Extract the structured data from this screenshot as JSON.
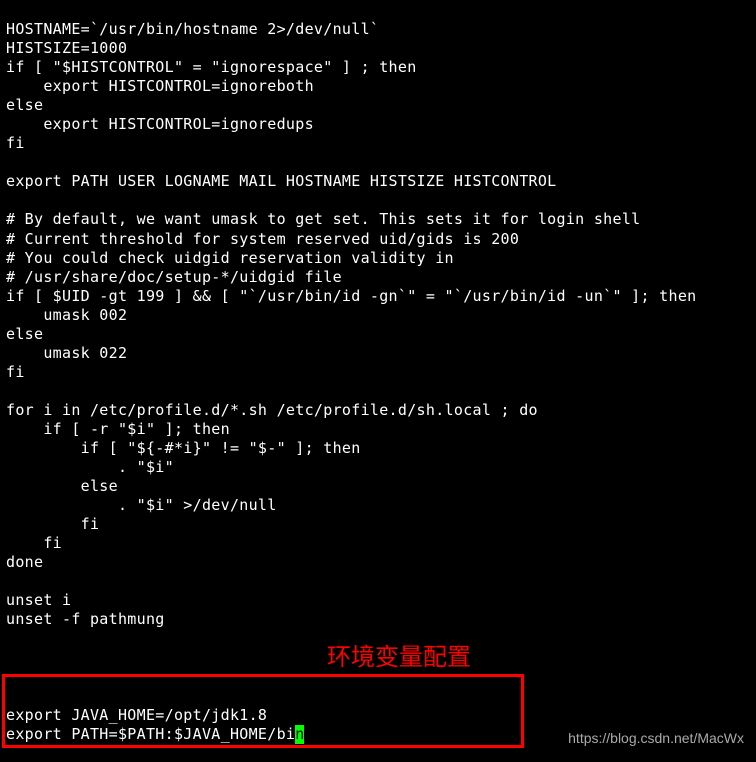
{
  "terminal": {
    "lines": [
      "HOSTNAME=`/usr/bin/hostname 2>/dev/null`",
      "HISTSIZE=1000",
      "if [ \"$HISTCONTROL\" = \"ignorespace\" ] ; then",
      "    export HISTCONTROL=ignoreboth",
      "else",
      "    export HISTCONTROL=ignoredups",
      "fi",
      "",
      "export PATH USER LOGNAME MAIL HOSTNAME HISTSIZE HISTCONTROL",
      "",
      "# By default, we want umask to get set. This sets it for login shell",
      "# Current threshold for system reserved uid/gids is 200",
      "# You could check uidgid reservation validity in",
      "# /usr/share/doc/setup-*/uidgid file",
      "if [ $UID -gt 199 ] && [ \"`/usr/bin/id -gn`\" = \"`/usr/bin/id -un`\" ]; then",
      "    umask 002",
      "else",
      "    umask 022",
      "fi",
      "",
      "for i in /etc/profile.d/*.sh /etc/profile.d/sh.local ; do",
      "    if [ -r \"$i\" ]; then",
      "        if [ \"${-#*i}\" != \"$-\" ]; then",
      "            . \"$i\"",
      "        else",
      "            . \"$i\" >/dev/null",
      "        fi",
      "    fi",
      "done",
      "",
      "unset i",
      "unset -f pathmung",
      "",
      "",
      "",
      "",
      "export JAVA_HOME=/opt/jdk1.8"
    ],
    "last_line_prefix": "export PATH=$PATH:$JAVA_HOME/bi",
    "cursor_char": "n"
  },
  "annotation": {
    "label": "环境变量配置"
  },
  "watermark": {
    "text": "https://blog.csdn.net/MacWx"
  }
}
